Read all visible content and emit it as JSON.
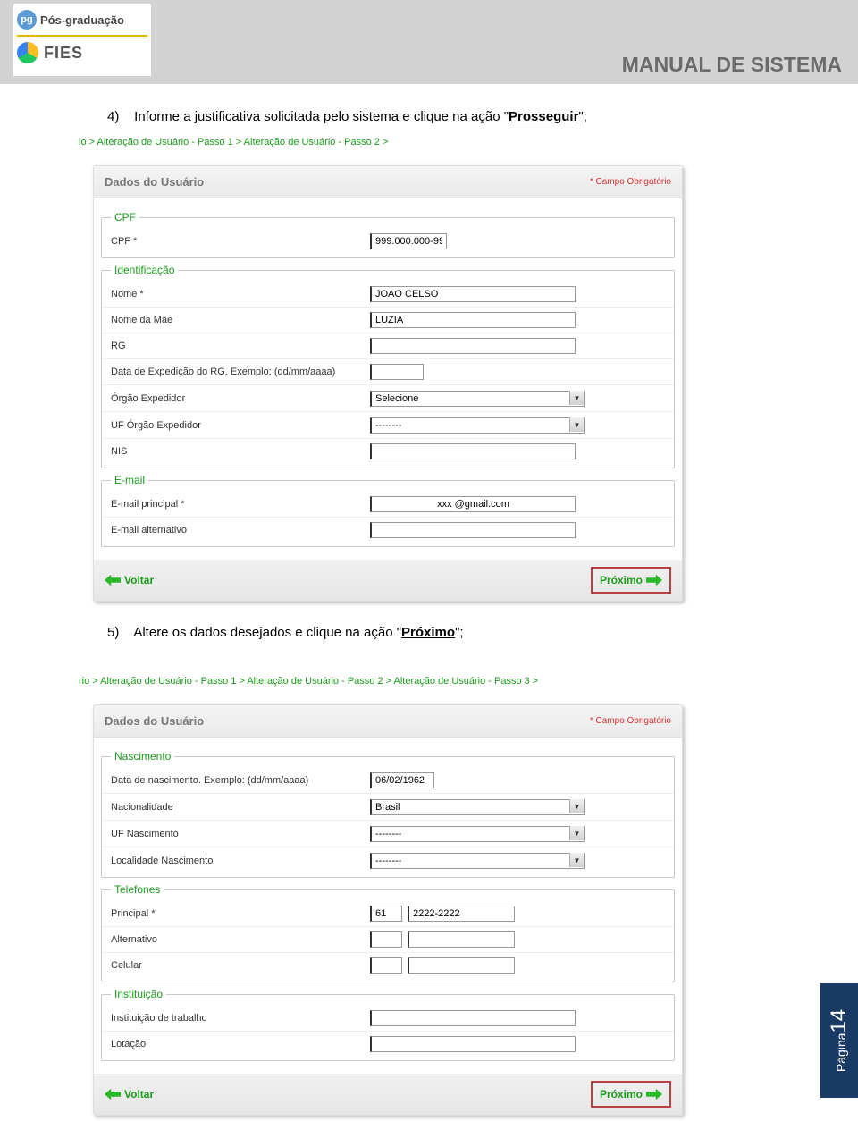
{
  "header": {
    "logo_pg_abbr": "pg",
    "logo_pg_text": "Pós-graduação",
    "logo_fies_text": "FIES",
    "title": "MANUAL DE SISTEMA"
  },
  "step4": {
    "num": "4)",
    "text_before": "Informe a justificativa solicitada pelo sistema e clique na ação \"",
    "action": "Prosseguir",
    "text_after": "\";",
    "breadcrumb": "io >  Alteração de Usuário - Passo 1 >  Alteração de Usuário - Passo 2 >",
    "panel_title": "Dados do Usuário",
    "required_note": "* Campo Obrigatório",
    "cpf": {
      "legend": "CPF",
      "label": "CPF *",
      "value": "999.000.000-99"
    },
    "ident": {
      "legend": "Identificação",
      "nome_label": "Nome *",
      "nome_value": "JOAO CELSO",
      "mae_label": "Nome da Mãe",
      "mae_value": "LUZIA",
      "rg_label": "RG",
      "rg_value": "",
      "dataexp_label": "Data de Expedição do RG. Exemplo: (dd/mm/aaaa)",
      "dataexp_value": "",
      "orgao_label": "Órgão Expedidor",
      "orgao_value": "Selecione",
      "uf_label": "UF Órgão Expedidor",
      "uf_value": "--------",
      "nis_label": "NIS",
      "nis_value": ""
    },
    "email": {
      "legend": "E-mail",
      "principal_label": "E-mail principal *",
      "principal_value": "xxx @gmail.com",
      "alt_label": "E-mail alternativo",
      "alt_value": ""
    },
    "btn_voltar": "Voltar",
    "btn_proximo": "Próximo"
  },
  "step5": {
    "num": "5)",
    "text_before": "Altere os dados desejados e clique na ação \"",
    "action": "Próximo",
    "text_after": "\";",
    "breadcrumb": "rio >  Alteração de Usuário - Passo 1 >  Alteração de Usuário - Passo 2 >  Alteração de Usuário - Passo 3 >",
    "panel_title": "Dados do Usuário",
    "required_note": "* Campo Obrigatório",
    "nasc": {
      "legend": "Nascimento",
      "data_label": "Data de nascimento. Exemplo: (dd/mm/aaaa)",
      "data_value": "06/02/1962",
      "nac_label": "Nacionalidade",
      "nac_value": "Brasil",
      "uf_label": "UF Nascimento",
      "uf_value": "--------",
      "local_label": "Localidade Nascimento",
      "local_value": "--------"
    },
    "tel": {
      "legend": "Telefones",
      "principal_label": "Principal *",
      "principal_ddd": "61",
      "principal_num": "2222-2222",
      "alt_label": "Alternativo",
      "alt_ddd": "",
      "alt_num": "",
      "cel_label": "Celular",
      "cel_ddd": "",
      "cel_num": ""
    },
    "inst": {
      "legend": "Instituição",
      "trab_label": "Instituição de trabalho",
      "trab_value": "",
      "lot_label": "Lotação",
      "lot_value": ""
    },
    "btn_voltar": "Voltar",
    "btn_proximo": "Próximo"
  },
  "page": {
    "label": "Página",
    "num": "14"
  }
}
